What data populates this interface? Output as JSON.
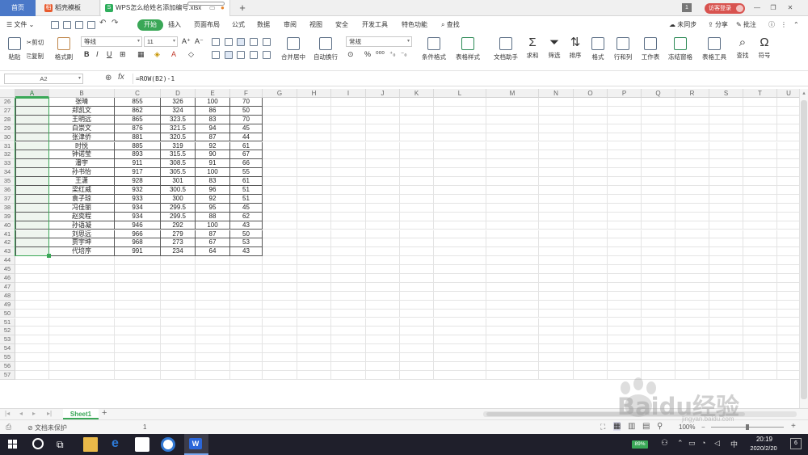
{
  "titlebar": {
    "home_tab": "首页",
    "tabs": [
      {
        "label": "稻壳模板",
        "icon": "docer-icon",
        "color": "#e85b2e"
      },
      {
        "label": "WPS怎么给姓名添加编号.xlsx",
        "icon": "spreadsheet-icon",
        "color": "#2eae5c"
      }
    ],
    "add_tab": "+",
    "page_badge": "1",
    "login": "访客登录",
    "accent": "#d8534f"
  },
  "menubar": {
    "file": "文件",
    "items": [
      "开始",
      "插入",
      "页面布局",
      "公式",
      "数据",
      "审阅",
      "视图",
      "安全",
      "开发工具",
      "特色功能"
    ],
    "search": "查找",
    "sync": "未同步",
    "share": "分享",
    "annotate": "批注",
    "start_color": "#3aa757"
  },
  "ribbon": {
    "paste": "粘贴",
    "cut": "剪切",
    "copy": "复制",
    "format_painter": "格式刷",
    "font_name": "等线",
    "font_size": "11",
    "merge": "合并居中",
    "wrap": "自动换行",
    "number_format": "常规",
    "cond_format": "条件格式",
    "table_style": "表格样式",
    "doc_helper": "文档助手",
    "sum": "求和",
    "filter": "筛选",
    "sort": "排序",
    "format": "格式",
    "rowcol": "行和列",
    "sheet": "工作表",
    "freeze": "冻结窗格",
    "table_tools": "表格工具",
    "find": "查找",
    "symbol": "符号"
  },
  "formula_bar": {
    "name_box": "A2",
    "fx": "fx",
    "formula": "=ROW(B2)-1"
  },
  "grid": {
    "columns": [
      "A",
      "B",
      "C",
      "D",
      "E",
      "F",
      "G",
      "H",
      "I",
      "J",
      "K",
      "L",
      "M",
      "N",
      "O",
      "P",
      "Q",
      "R",
      "S",
      "T",
      "U"
    ],
    "row_numbers": [
      "26",
      "27",
      "28",
      "29",
      "30",
      "31",
      "32",
      "33",
      "34",
      "35",
      "36",
      "37",
      "38",
      "39",
      "40",
      "41",
      "42",
      "43",
      "44",
      "45",
      "46",
      "47",
      "48",
      "49",
      "50",
      "51",
      "52",
      "53",
      "54",
      "55",
      "56",
      "57"
    ],
    "rows": [
      [
        "",
        "张晴",
        "855",
        "326",
        "100",
        "70"
      ],
      [
        "",
        "郑凯文",
        "862",
        "324",
        "86",
        "50"
      ],
      [
        "",
        "王明远",
        "865",
        "323.5",
        "83",
        "70"
      ],
      [
        "",
        "白崇文",
        "876",
        "321.5",
        "94",
        "45"
      ],
      [
        "",
        "张津侨",
        "881",
        "320.5",
        "87",
        "44"
      ],
      [
        "",
        "时悦",
        "885",
        "319",
        "92",
        "61"
      ],
      [
        "",
        "钟诺莹",
        "893",
        "315.5",
        "90",
        "67"
      ],
      [
        "",
        "潘宇",
        "911",
        "308.5",
        "91",
        "66"
      ],
      [
        "",
        "孙书怡",
        "917",
        "305.5",
        "100",
        "55"
      ],
      [
        "",
        "王潇",
        "928",
        "301",
        "83",
        "61"
      ],
      [
        "",
        "梁红威",
        "932",
        "300.5",
        "96",
        "51"
      ],
      [
        "",
        "袁子琼",
        "933",
        "300",
        "92",
        "51"
      ],
      [
        "",
        "冯佳丽",
        "934",
        "299.5",
        "95",
        "45"
      ],
      [
        "",
        "赵奕程",
        "934",
        "299.5",
        "88",
        "62"
      ],
      [
        "",
        "孙语凝",
        "946",
        "292",
        "100",
        "43"
      ],
      [
        "",
        "刘思远",
        "966",
        "279",
        "87",
        "50"
      ],
      [
        "",
        "贾宇坤",
        "968",
        "273",
        "67",
        "53"
      ],
      [
        "",
        "代培序",
        "991",
        "234",
        "64",
        "43"
      ]
    ]
  },
  "sheets": {
    "active": "Sheet1",
    "add": "+",
    "active_color": "#3aa757"
  },
  "statusbar": {
    "protect": "文档未保护",
    "count": "1",
    "zoom": "100%"
  },
  "taskbar": {
    "battery": "89%",
    "ime": "中",
    "time": "20:19",
    "date": "2020/2/20",
    "notif": "6"
  },
  "watermark": {
    "text": "Baidu经验",
    "url": "jingyan.baidu.com"
  }
}
